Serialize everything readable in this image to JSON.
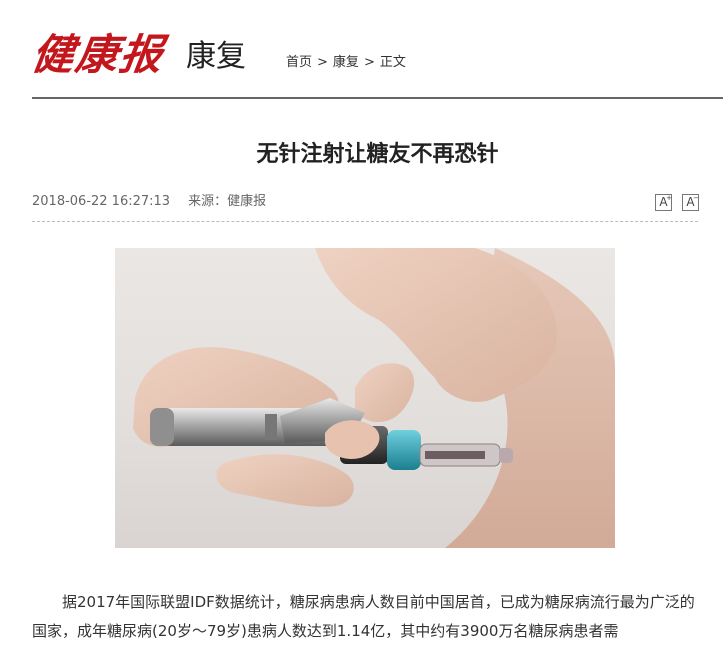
{
  "header": {
    "logo_text": "健康报",
    "section_title": "康复",
    "breadcrumb": [
      "首页",
      "康复",
      "正文"
    ],
    "breadcrumb_sep": ">"
  },
  "article": {
    "title": "无针注射让糖友不再恐针",
    "date": "2018-06-22 16:27:13",
    "source": "来源：健康报",
    "font_increase_label": "A",
    "font_decrease_label": "A",
    "image_subject": "needle-free injector pressed against abdomen",
    "paragraph": "据2017年国际联盟IDF数据统计，糖尿病患病人数目前中国居首，已成为糖尿病流行最为广泛的国家，成年糖尿病(20岁～79岁)患病人数达到1.14亿，其中约有3900万名糖尿病患者需"
  },
  "colors": {
    "logo_red": "#c4171d",
    "rule_gray": "#666666",
    "injector_teal": "#2aa6b8"
  }
}
